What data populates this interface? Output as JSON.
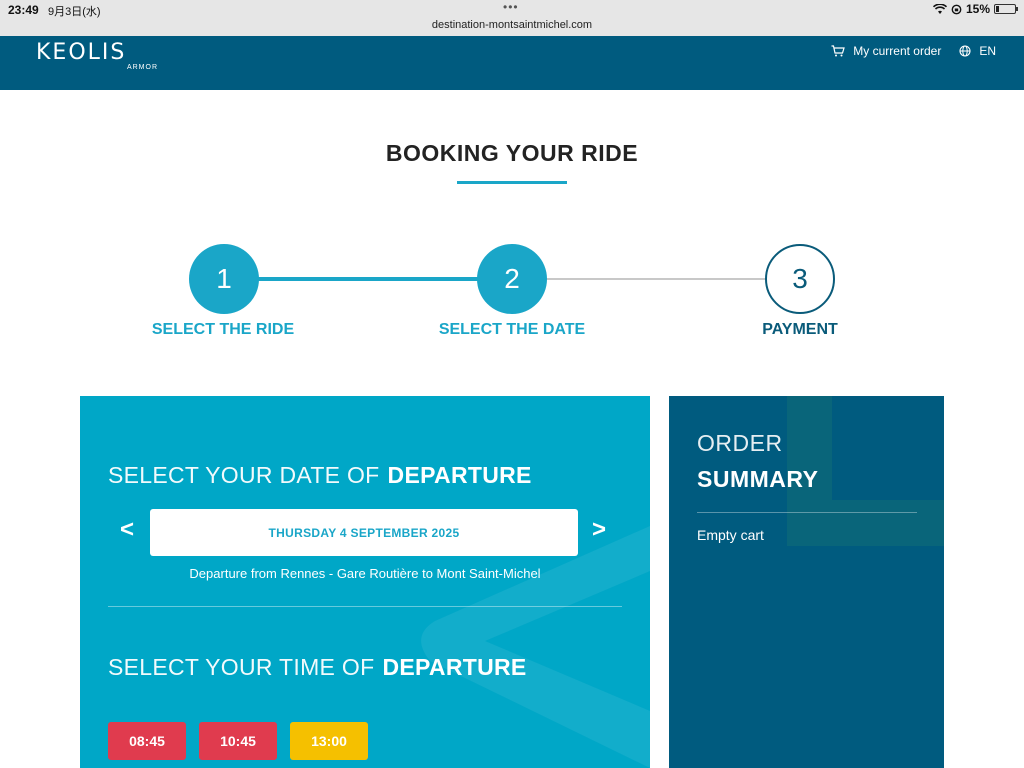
{
  "statusbar": {
    "time": "23:49",
    "date": "9月3日(水)",
    "dots": "•••",
    "url": "destination-montsaintmichel.com",
    "battery_text": "15%",
    "battery_level": 0.15
  },
  "header": {
    "logo": "KEOLIS",
    "logo_sub": "ARMOR",
    "cart_label": "My current order",
    "lang_label": "EN"
  },
  "page": {
    "title": "BOOKING YOUR RIDE"
  },
  "steps": [
    {
      "number": "1",
      "label": "SELECT THE RIDE",
      "state": "active"
    },
    {
      "number": "2",
      "label": "SELECT THE DATE",
      "state": "active"
    },
    {
      "number": "3",
      "label": "PAYMENT",
      "state": "inactive"
    }
  ],
  "booking": {
    "date_title_light": "SELECT YOUR DATE OF",
    "date_title_bold": "DEPARTURE",
    "prev_label": "<",
    "next_label": ">",
    "selected_date": "THURSDAY 4 SEPTEMBER 2025",
    "route": "Departure from Rennes - Gare Routière to Mont Saint-Michel",
    "time_title_light": "SELECT YOUR TIME OF",
    "time_title_bold": "DEPARTURE",
    "slots": [
      {
        "time": "08:45",
        "status_color": "#e03b4e"
      },
      {
        "time": "10:45",
        "status_color": "#e03b4e"
      },
      {
        "time": "13:00",
        "status_color": "#f5c000"
      }
    ]
  },
  "summary": {
    "title_light": "ORDER",
    "title_bold": "SUMMARY",
    "empty_text": "Empty cart"
  },
  "colors": {
    "brand_dark": "#005b7f",
    "brand_accent": "#1aa6c8",
    "panel": "#00a7c7"
  }
}
